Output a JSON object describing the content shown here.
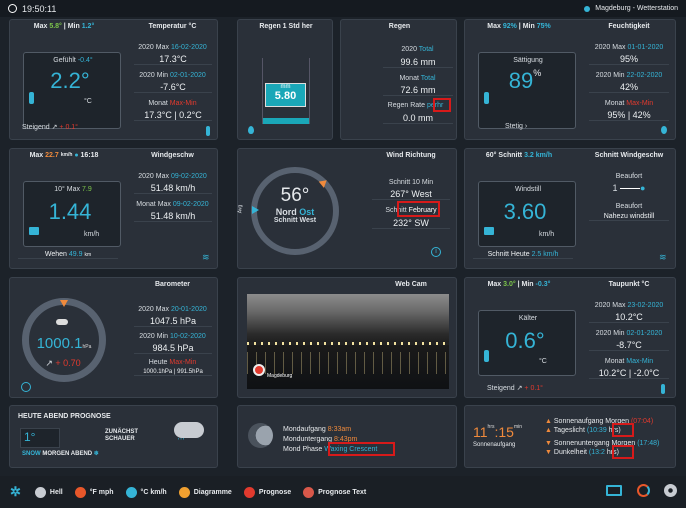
{
  "topbar": {
    "time": "19:50:11",
    "location": "Magdeburg - Wetterstation"
  },
  "temp": {
    "max_label": "Max",
    "max_val": "5.8°",
    "min_label": "Min",
    "min_val": "1.2°",
    "title": "Temperatur °C",
    "feel_label": "Gefühlt",
    "feel_val": "-0.4°",
    "current": "2.2°",
    "unit": "°C",
    "max2020_label": "2020 Max",
    "max2020_date": "16-02-2020",
    "max2020_val": "17.3°C",
    "min2020_label": "2020 Min",
    "min2020_date": "02-01-2020",
    "min2020_val": "-7.6°C",
    "month_label": "Monat",
    "month_maxmin": "Max-Min",
    "month_val": "17.3°C | 0.2°C",
    "trend_label": "Steigend",
    "trend_val": "+ 0.1°"
  },
  "rainrate": {
    "title": "Regen 1 Std her",
    "unit": "mm",
    "value": "5.80"
  },
  "rain": {
    "title": "Regen",
    "total_label": "2020",
    "total_suffix": "Total",
    "total_val": "99.6 mm",
    "month_label": "Monat",
    "month_suffix": "Total",
    "month_val": "72.6 mm",
    "rate_label": "Regen Rate",
    "rate_per": "per",
    "rate_hr": "hr",
    "rate_val": "0.0 mm"
  },
  "humidity": {
    "max_label": "Max",
    "max_val": "92%",
    "min_label": "Min",
    "min_val": "75%",
    "title": "Feuchtigkeit",
    "status": "Sättigung",
    "current": "89",
    "unit": "%",
    "max2020_label": "2020 Max",
    "max2020_date": "01-01-2020",
    "max2020_val": "95%",
    "min2020_label": "2020 Min",
    "min2020_date": "22-02-2020",
    "min2020_val": "42%",
    "month_label": "Monat",
    "month_maxmin": "Max-Min",
    "month_val": "95% | 42%",
    "trend": "Stetig"
  },
  "wind": {
    "max_label": "Max",
    "max_val": "22.7",
    "max_unit": "km/h",
    "max_time": "16:18",
    "title": "Windgeschw",
    "tenmax_label": "10° Max",
    "tenmax_val": "7.9",
    "current": "1.44",
    "unit": "km/h",
    "max2020_label": "2020 Max",
    "max2020_date": "09-02-2020",
    "max2020_val": "51.48 km/h",
    "month_label": "Monat Max",
    "month_date": "09-02-2020",
    "month_val": "51.48 km/h",
    "gust_label": "Wehen",
    "gust_val": "49.9",
    "gust_unit": "km"
  },
  "direction": {
    "title": "Wind Richtung",
    "deg": "56°",
    "dir1": "Nord",
    "dir2": "Ost",
    "avg": "Schnitt West",
    "avg_side": "Avg",
    "ten_label": "Schnitt 10 Min",
    "ten_deg": "267°",
    "ten_dir": "West",
    "month_label": "Schnitt",
    "month_highlight": "February",
    "month_deg": "232°",
    "month_dir": "SW"
  },
  "avgwind": {
    "head_left": "60° Schnitt",
    "head_left_val": "3.2 km/h",
    "title": "Schnitt Windgeschw",
    "status": "Windstill",
    "current": "3.60",
    "unit": "km/h",
    "beaufort_label": "Beaufort",
    "beaufort_val": "1",
    "beaufort2_label": "Beaufort",
    "beaufort2_val": "Nahezu windstill",
    "today_label": "Schnitt Heute",
    "today_val": "2.5 km/h"
  },
  "baro": {
    "title": "Barometer",
    "current": "1000.1",
    "unit": "hPa",
    "trend": "+ 0.70",
    "max2020_label": "2020 Max",
    "max2020_date": "20-01-2020",
    "max2020_val": "1047.5 hPa",
    "min2020_label": "2020 Min",
    "min2020_date": "10-02-2020",
    "min2020_val": "984.5 hPa",
    "today_label": "Heute",
    "today_maxmin": "Max-Min",
    "today_val": "1000.1hPa | 991.5hPa"
  },
  "webcam": {
    "title": "Web Cam",
    "caption": "Magdeburg"
  },
  "dew": {
    "max_label": "Max",
    "max_val": "3.0°",
    "min_label": "Min",
    "min_val": "-0.3°",
    "title": "Taupunkt °C",
    "status": "Kälter",
    "current": "0.6°",
    "unit": "°C",
    "max2020_label": "2020 Max",
    "max2020_date": "23-02-2020",
    "max2020_val": "10.2°C",
    "min2020_label": "2020 Min",
    "min2020_date": "02-01-2020",
    "min2020_val": "-8.7°C",
    "month_label": "Monat",
    "month_maxmin": "Max-Min",
    "month_val": "10.2°C | -2.0°C",
    "trend_label": "Steigend",
    "trend_val": "+ 0.1°"
  },
  "forecast": {
    "title": "HEUTE ABEND PROGNOSE",
    "temp": "1°",
    "text1": "ZUNÄCHST",
    "text2": "SCHAUER",
    "snow": "SNOW",
    "evening": "MORGEN ABEND"
  },
  "moon": {
    "rise_label": "Mondaufgang",
    "rise_val": "8:33am",
    "set_label": "Monduntergang",
    "set_val": "8:43pm",
    "phase_label": "Mond Phase",
    "phase_val": "Waxing Crescent"
  },
  "sun": {
    "hrs": "11",
    "hrs_unit": "hrs",
    "min": "15",
    "min_unit": "min",
    "label": "Sonnenaufgang",
    "rise_label": "Sonnenaufgang Morgen",
    "rise_val": "(07:04)",
    "day_label": "Tageslicht",
    "day_val": "(10:39",
    "day_hrs": "hrs)",
    "set_label": "Sonnenuntergang Morgen",
    "set_val": "(17:48)",
    "dark_label": "Dunkelheit",
    "dark_val": "(13:2",
    "dark_hrs": "hrs)"
  },
  "bottombar": {
    "hell": "Hell",
    "f_mph": "°F mph",
    "c_kmh": "°C km/h",
    "diagramme": "Diagramme",
    "prognose": "Prognose",
    "prognose_text": "Prognose Text"
  },
  "colors": {
    "accent": "#35b4d6",
    "green": "#7cc44b",
    "red": "#e23a2e",
    "highlight": "#d71a1a"
  }
}
